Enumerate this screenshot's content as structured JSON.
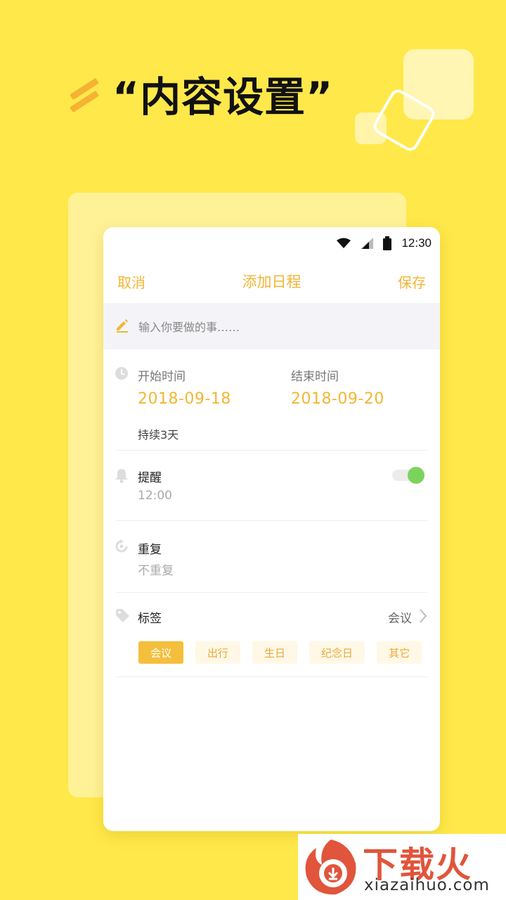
{
  "headline": "“内容设置”",
  "status_bar": {
    "time": "12:30"
  },
  "header": {
    "cancel": "取消",
    "title": "添加日程",
    "save": "保存"
  },
  "input": {
    "placeholder": "输入你要做的事……"
  },
  "schedule": {
    "start_label": "开始时间",
    "start_value": "2018-09-18",
    "end_label": "结束时间",
    "end_value": "2018-09-20",
    "duration": "持续3天"
  },
  "reminder": {
    "title": "提醒",
    "time": "12:00",
    "enabled": true
  },
  "repeat": {
    "title": "重复",
    "value": "不重复"
  },
  "tags": {
    "title": "标签",
    "selected": "会议",
    "options": [
      "会议",
      "出行",
      "生日",
      "纪念日",
      "其它"
    ]
  },
  "watermark": {
    "text": "下载火",
    "domain": "xiazaihuo.com"
  },
  "colors": {
    "background": "#FFE84A",
    "accent": "#F2B634",
    "toggle_on": "#7CD35C"
  }
}
